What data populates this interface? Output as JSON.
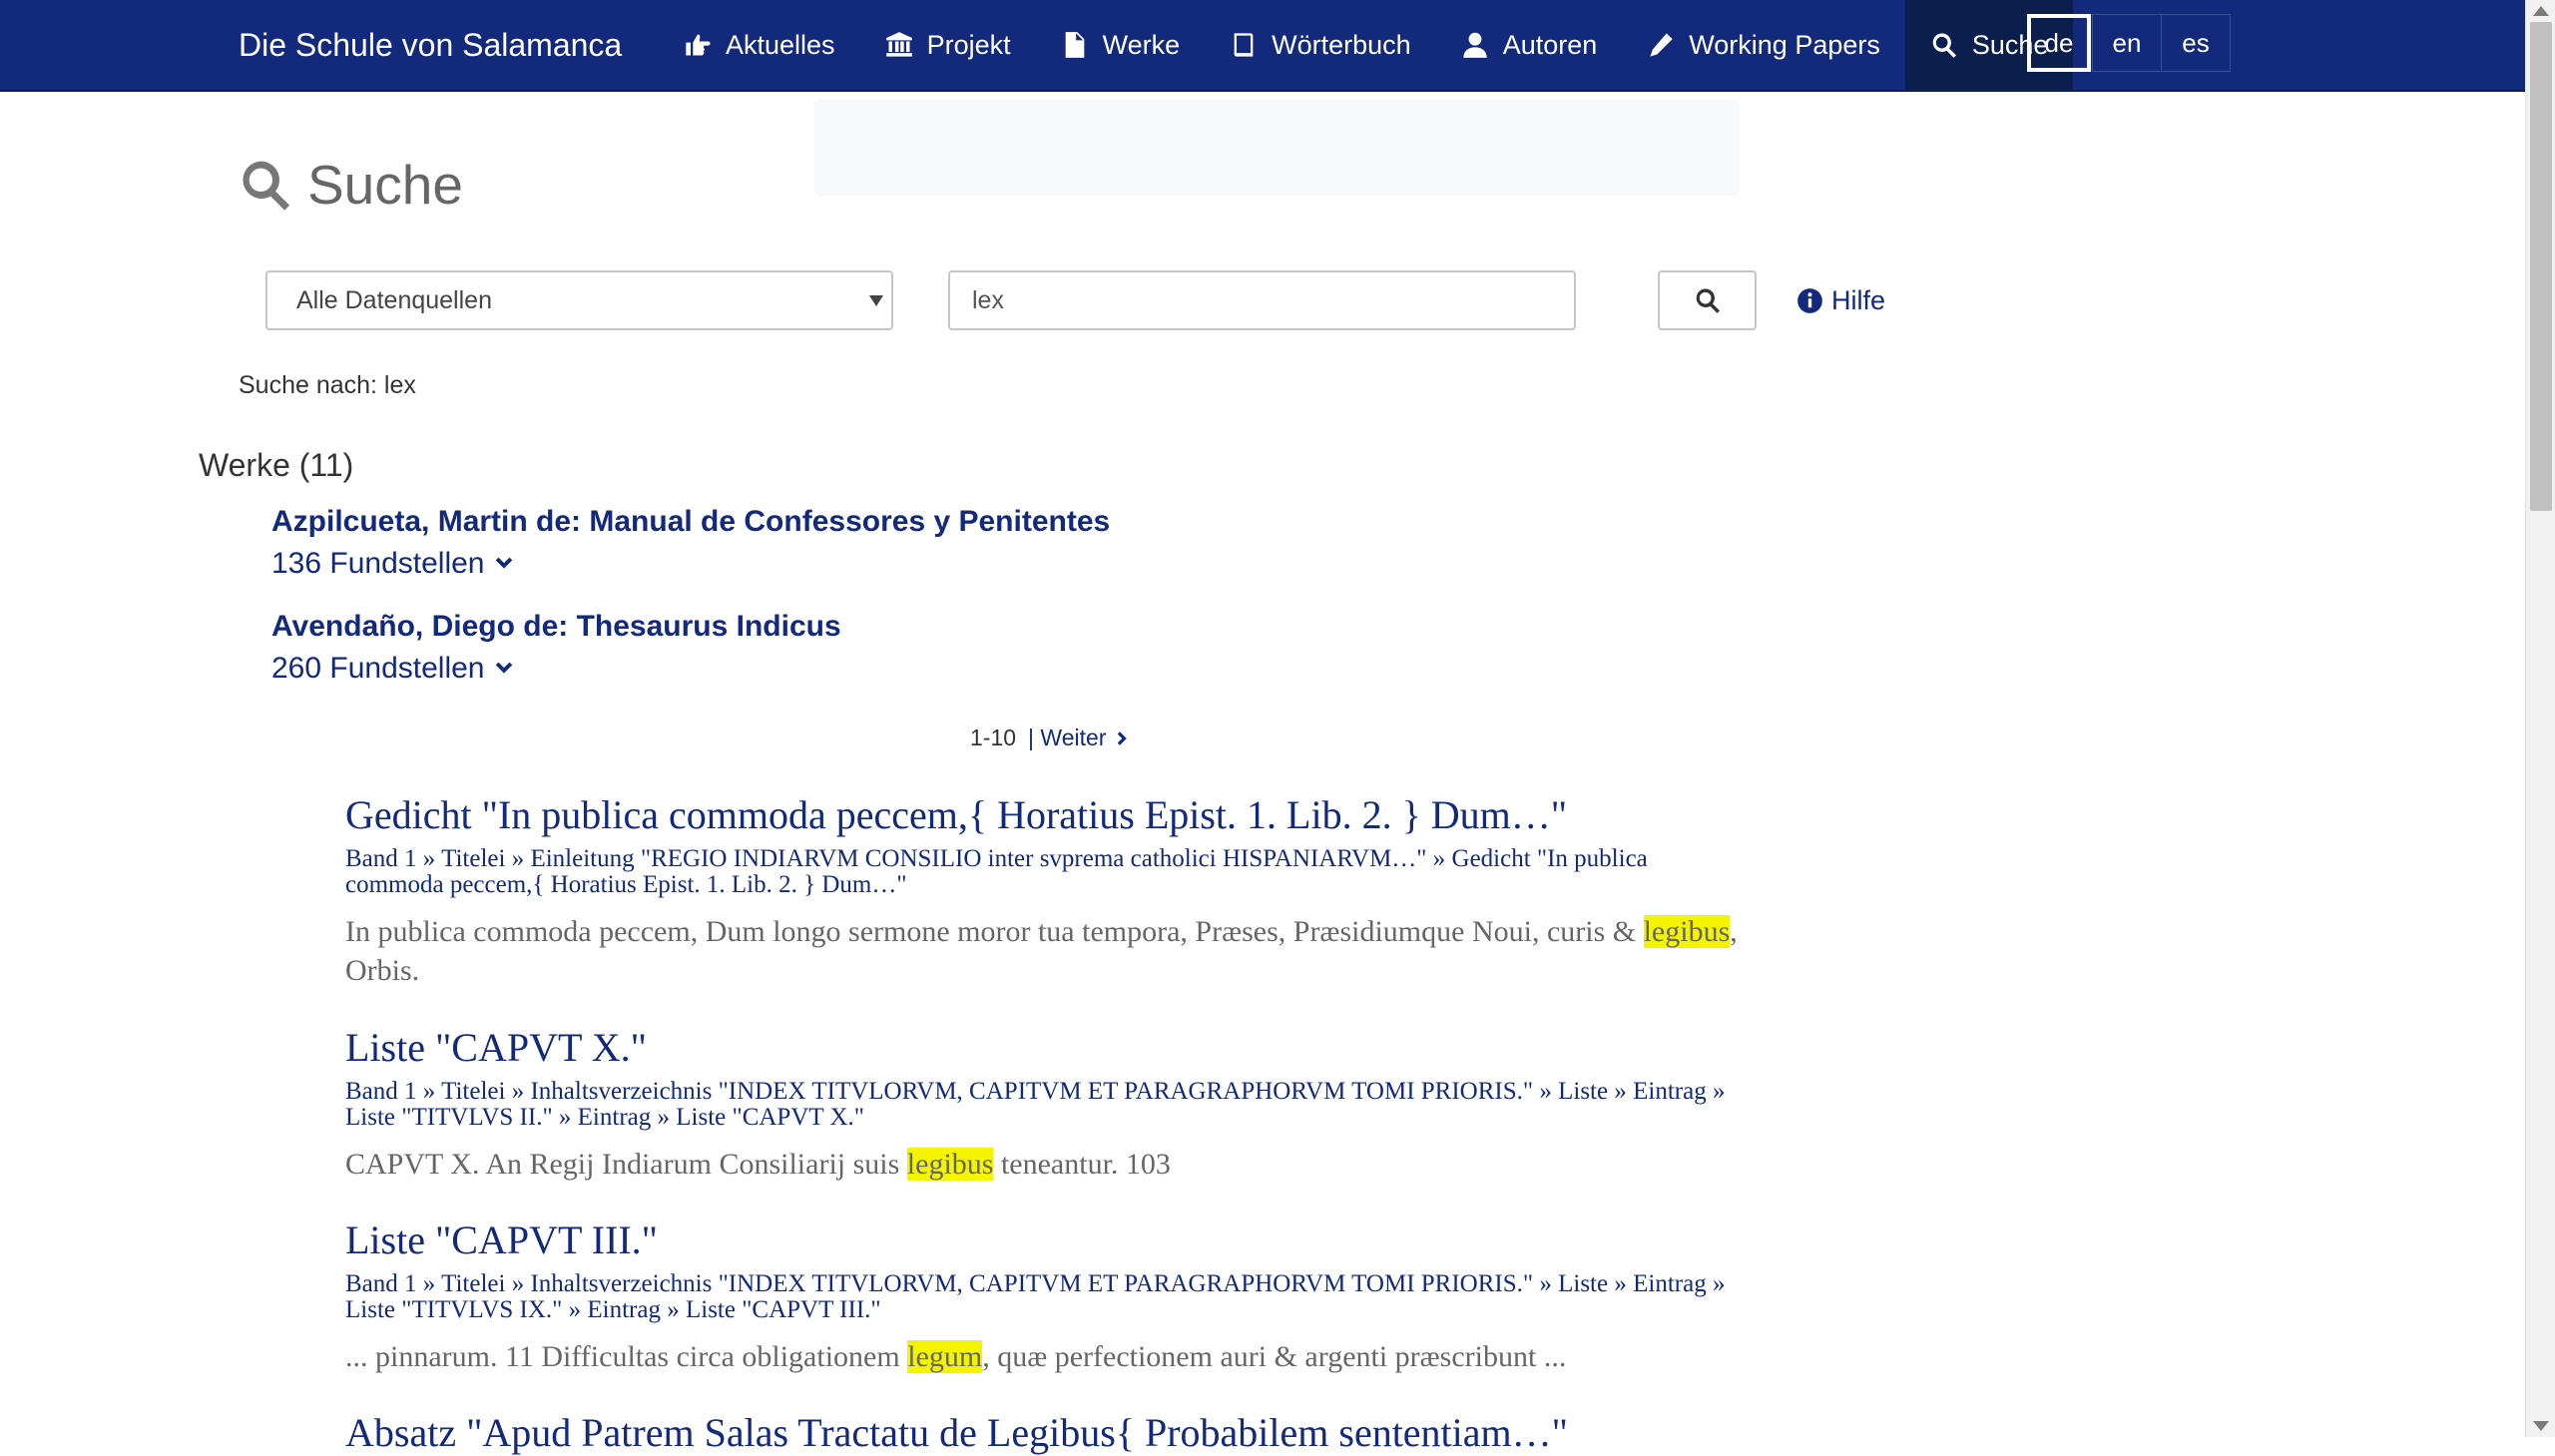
{
  "navbar": {
    "brand": "Die Schule von Salamanca",
    "items": [
      {
        "label": "Aktuelles",
        "icon": "hand-point-right-icon"
      },
      {
        "label": "Projekt",
        "icon": "institution-icon"
      },
      {
        "label": "Werke",
        "icon": "file-icon"
      },
      {
        "label": "Wörterbuch",
        "icon": "book-icon"
      },
      {
        "label": "Autoren",
        "icon": "user-icon"
      },
      {
        "label": "Working Papers",
        "icon": "pencil-icon"
      },
      {
        "label": "Suche",
        "icon": "search-icon",
        "active": true
      }
    ],
    "languages": [
      {
        "label": "de",
        "active": true
      },
      {
        "label": "en"
      },
      {
        "label": "es"
      }
    ]
  },
  "page": {
    "title": "Suche"
  },
  "search": {
    "source_selected": "Alle Datenquellen",
    "query": "lex",
    "help_label": "Hilfe",
    "search_for_label": "Suche nach: lex"
  },
  "results": {
    "section_heading": "Werke (11)",
    "works": [
      {
        "title": "Azpilcueta, Martin de: Manual de Confessores y Penitentes",
        "count": "136 Fundstellen"
      },
      {
        "title": "Avendaño, Diego de: Thesaurus Indicus",
        "count": "260 Fundstellen"
      }
    ],
    "pagination": {
      "range": "1-10",
      "next": "| Weiter"
    },
    "hits": [
      {
        "title": "Gedicht \"In publica commoda peccem,{ Horatius Epist. 1. Lib. 2. } Dum…\"",
        "crumbs": [
          "Band 1",
          "Titelei",
          "Einleitung \"REGIO INDIARVM CONSILIO inter svprema catholici HISPANIARVM…\"",
          "Gedicht \"In publica commoda peccem,{ Horatius Epist. 1. Lib. 2. } Dum…\""
        ],
        "snippet_before": "In publica commoda peccem, Dum longo sermone moror tua tempora, Præses, Præsidiumque Noui, curis & ",
        "snippet_match": "legibus",
        "snippet_after": ", Orbis."
      },
      {
        "title": "Liste \"CAPVT X.\"",
        "crumbs": [
          "Band 1",
          "Titelei",
          "Inhaltsverzeichnis \"INDEX TITVLORVM, CAPITVM ET PARAGRAPHORVM TOMI PRIORIS.\"",
          "Liste",
          "Eintrag",
          "Liste \"TITVLVS II.\"",
          "Eintrag",
          "Liste \"CAPVT X.\""
        ],
        "snippet_before": "CAPVT X. An Regij Indiarum Consiliarij suis ",
        "snippet_match": "legibus",
        "snippet_after": " teneantur. 103"
      },
      {
        "title": "Liste \"CAPVT III.\"",
        "crumbs": [
          "Band 1",
          "Titelei",
          "Inhaltsverzeichnis \"INDEX TITVLORVM, CAPITVM ET PARAGRAPHORVM TOMI PRIORIS.\"",
          "Liste",
          "Eintrag",
          "Liste \"TITVLVS IX.\"",
          "Eintrag",
          "Liste \"CAPVT III.\""
        ],
        "snippet_before": "... pinnarum. 11 Difficultas circa obligationem ",
        "snippet_match": "legum",
        "snippet_after": ", quæ perfectionem auri & argenti præscribunt ..."
      },
      {
        "title": "Absatz \"Apud Patrem Salas Tractatu de Legibus{ Probabilem sententiam…\""
      }
    ]
  },
  "colors": {
    "navbar": "#13297c",
    "active_nav": "#0b1f4e",
    "link": "#13297c",
    "highlight": "#f4f400"
  }
}
